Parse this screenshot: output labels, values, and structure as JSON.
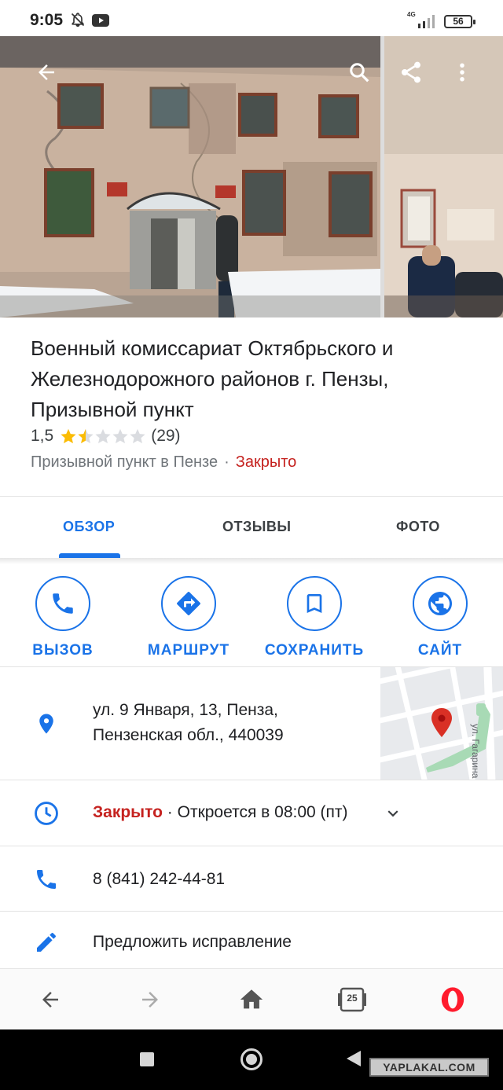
{
  "status_bar": {
    "time": "9:05",
    "network": "4G",
    "battery": "56"
  },
  "place": {
    "title": "Военный комиссариат Октябрьского и Железнодорожного районов г. Пензы, Призывной пункт",
    "rating": "1,5",
    "rating_value": 1.5,
    "rating_max": 5,
    "review_count": "(29)",
    "category": "Призывной пункт в Пензе",
    "separator": "·",
    "open_status": "Закрыто"
  },
  "tabs": [
    {
      "label": "ОБЗОР",
      "active": true
    },
    {
      "label": "ОТЗЫВЫ",
      "active": false
    },
    {
      "label": "ФОТО",
      "active": false
    }
  ],
  "actions": {
    "call": "ВЫЗОВ",
    "route": "МАРШРУТ",
    "save": "СОХРАНИТЬ",
    "site": "САЙТ"
  },
  "info": {
    "address_line1": "ул. 9 Января, 13, Пенза,",
    "address_line2": "Пензенская обл., 440039",
    "map_street_label": "ул. Гагарина",
    "hours_status": "Закрыто",
    "hours_next": " · Откроется в 08:00 (пт)",
    "phone": "8 (841) 242-44-81",
    "suggest_edit": "Предложить исправление"
  },
  "browser_bar": {
    "tab_count": "25"
  },
  "watermark": "YAPLAKAL.COM",
  "colors": {
    "accent": "#1a73e8",
    "closed": "#c5221f",
    "star": "#fbbc04",
    "pin": "#d93025"
  }
}
